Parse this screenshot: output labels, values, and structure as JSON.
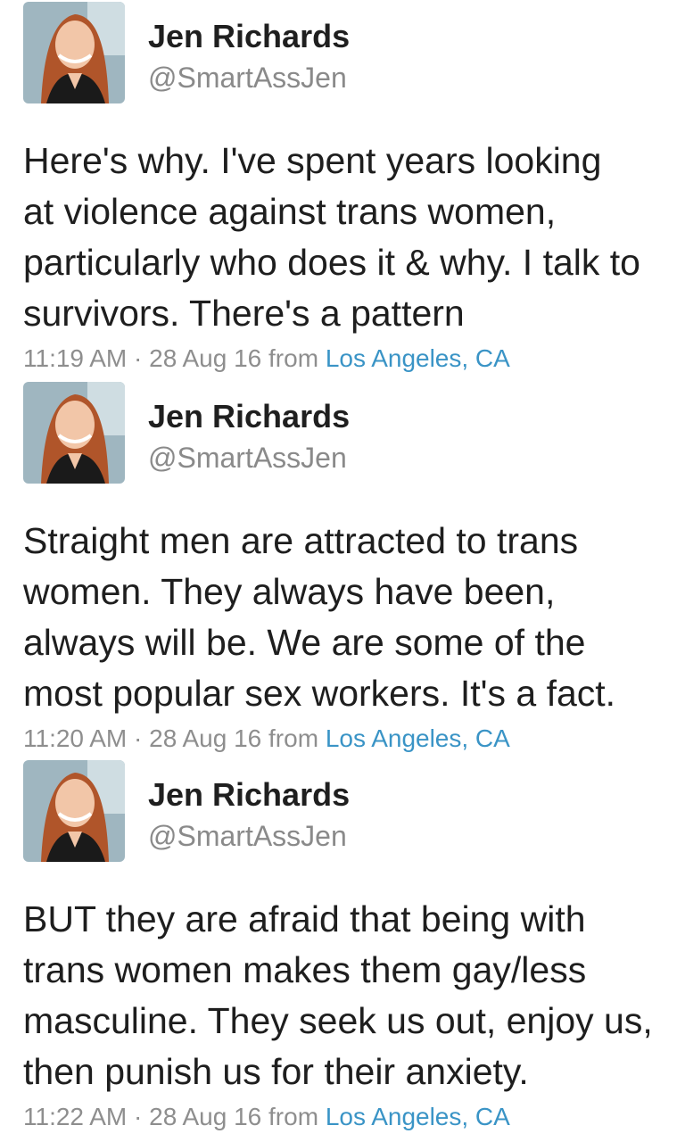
{
  "tweets": [
    {
      "name": "Jen Richards",
      "handle": "@SmartAssJen",
      "lines": [
        "Here's why. I've spent years looking",
        "at violence against trans women,",
        "particularly who does it & why. I talk to",
        "survivors. There's a pattern"
      ],
      "time": "11:19 AM",
      "sep": "·",
      "date": "28 Aug 16",
      "from": "from",
      "location": "Los Angeles, CA"
    },
    {
      "name": "Jen Richards",
      "handle": "@SmartAssJen",
      "lines": [
        "Straight men are attracted to trans",
        "women. They always have been,",
        "always will be. We are some of the",
        "most popular sex workers. It's a fact."
      ],
      "time": "11:20 AM",
      "sep": "·",
      "date": "28 Aug 16",
      "from": "from",
      "location": "Los Angeles, CA"
    },
    {
      "name": "Jen Richards",
      "handle": "@SmartAssJen",
      "lines": [
        "BUT they are afraid that being with",
        "trans women makes them gay/less",
        "masculine. They seek us out, enjoy us,",
        "then punish us for their anxiety."
      ],
      "time": "11:22 AM",
      "sep": "·",
      "date": "28 Aug 16",
      "from": "from",
      "location": "Los Angeles, CA"
    }
  ],
  "colors": {
    "location_link": "#3a94c6",
    "meta_text": "#8e8e8e",
    "handle_text": "#8a8a8a"
  },
  "icons": {
    "avatar": "profile-photo-avatar"
  }
}
